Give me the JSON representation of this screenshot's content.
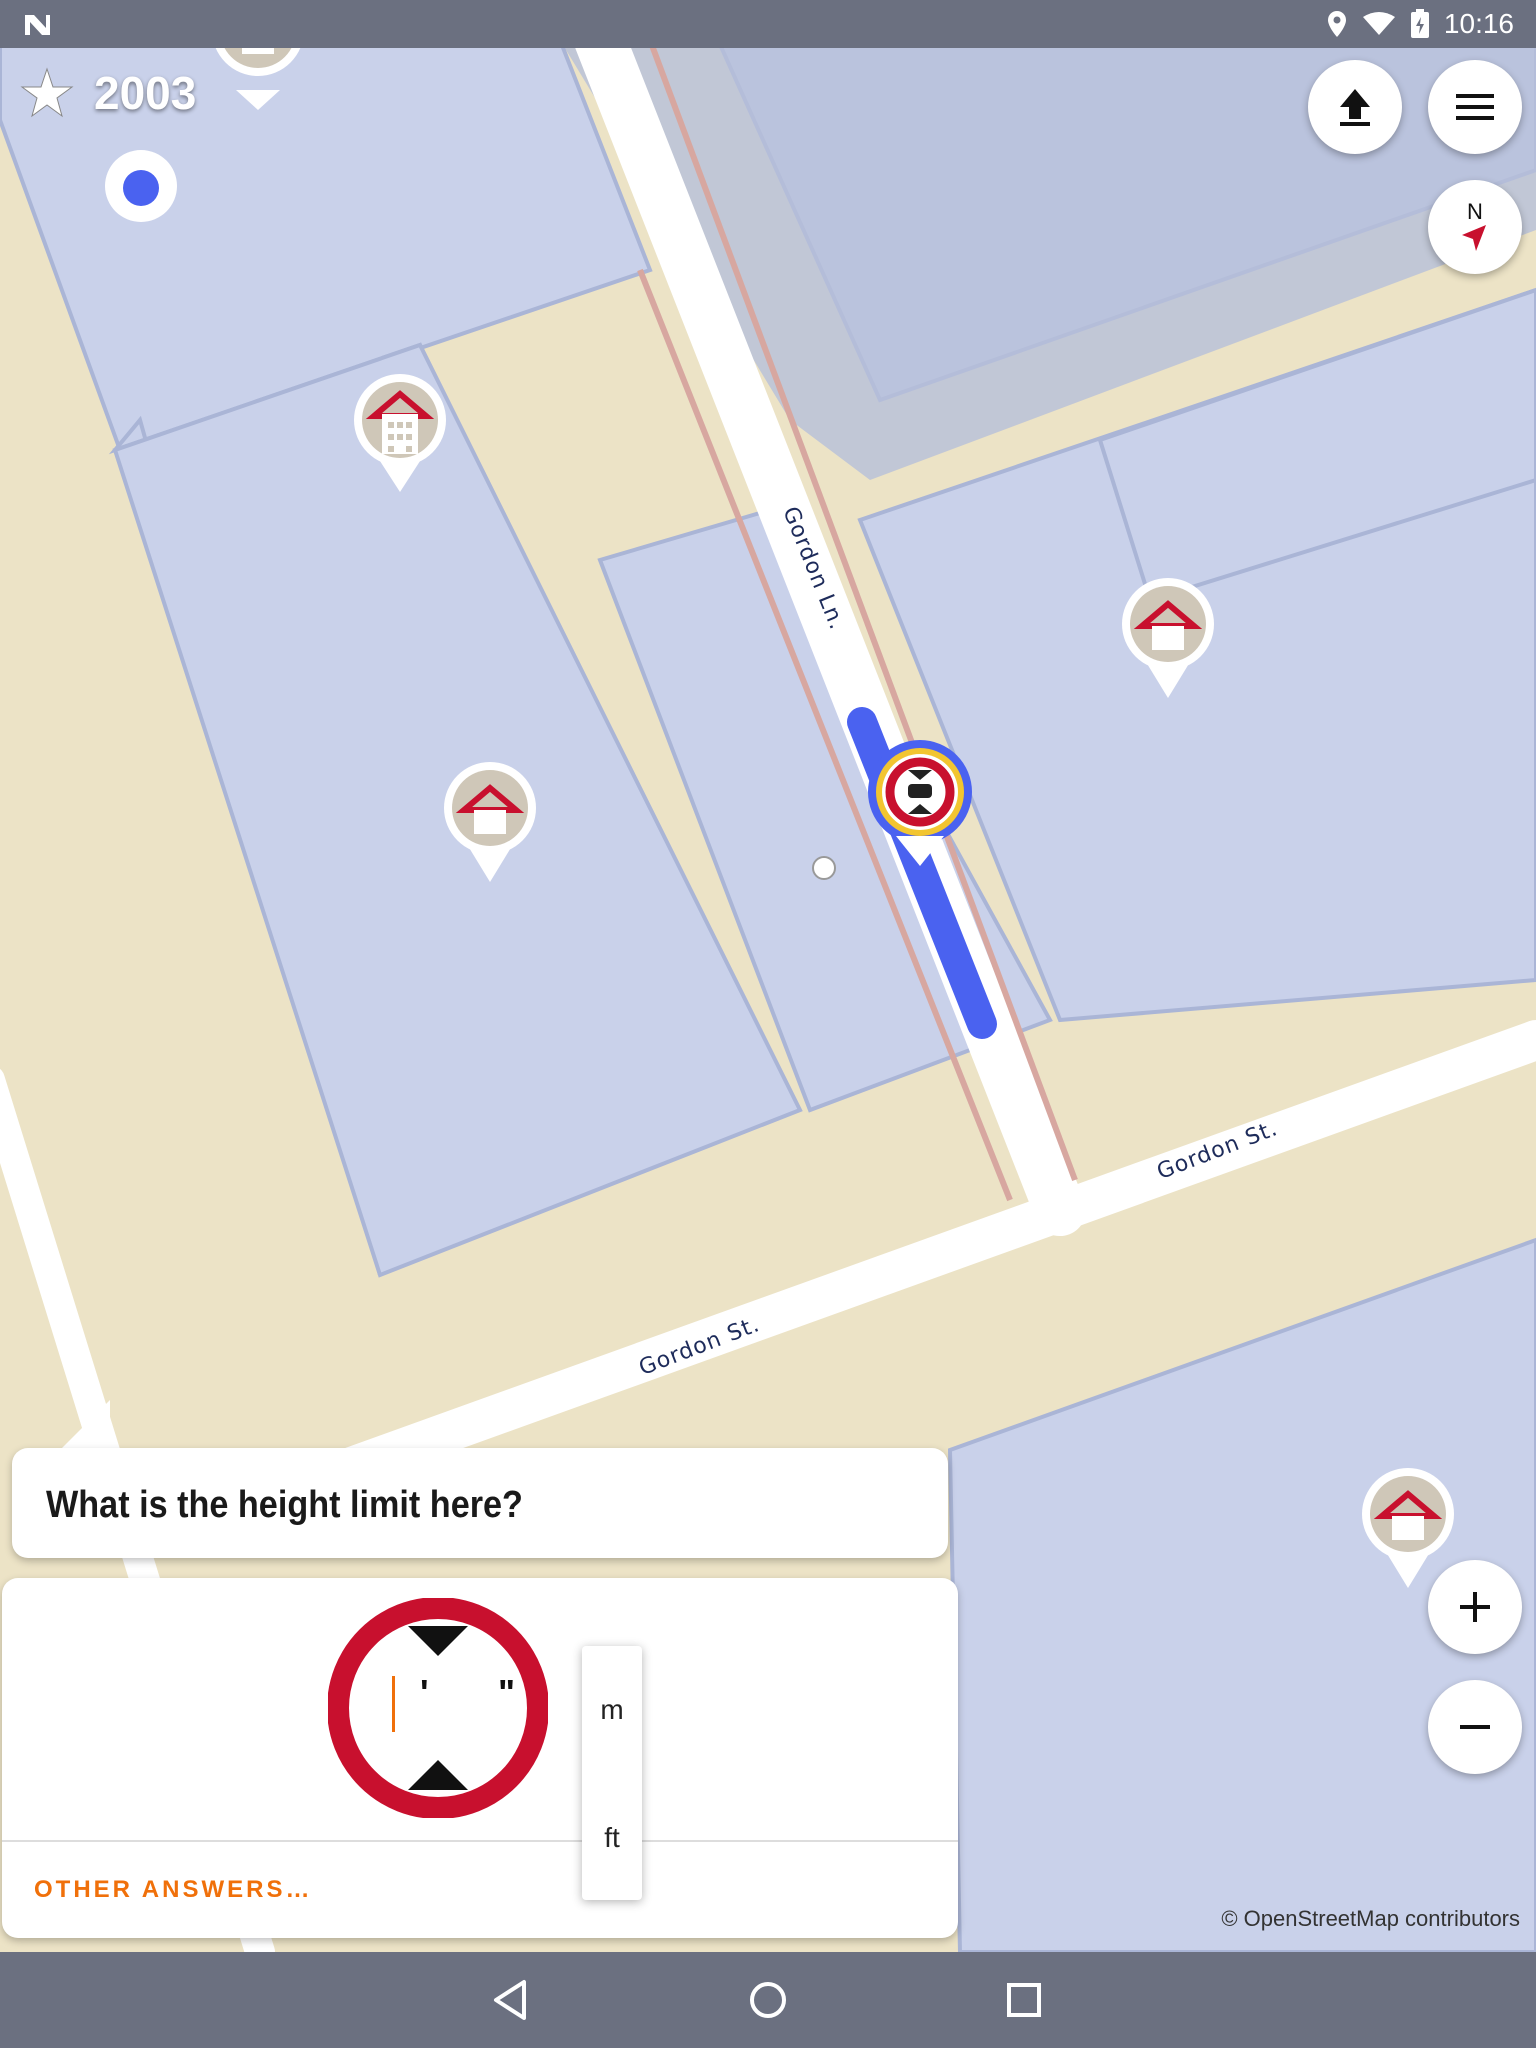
{
  "status_bar": {
    "time": "10:16"
  },
  "map": {
    "streets": [
      "Gordon Ln.",
      "Gordon St.",
      "Gordon St."
    ],
    "attribution": "© OpenStreetMap contributors"
  },
  "header": {
    "star_count": "2003"
  },
  "quest": {
    "question": "What is the height limit here?",
    "feet_mark": "'",
    "inch_mark": "\"",
    "units": [
      "m",
      "ft"
    ],
    "other_answers": "OTHER ANSWERS…"
  },
  "compass": {
    "label": "N"
  },
  "colors": {
    "accent_orange": "#f0700a",
    "sign_red": "#c8102e",
    "highlight_blue": "#4a62f0",
    "building": "#c9d1ea",
    "land": "#ece3c6"
  }
}
